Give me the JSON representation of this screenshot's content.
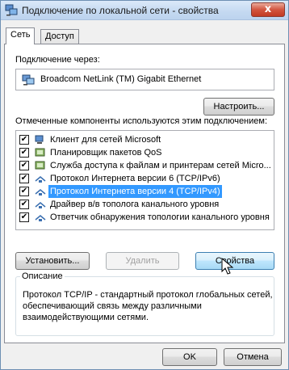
{
  "window": {
    "title": "Подключение по локальной сети - свойства",
    "close_glyph": "x"
  },
  "tabs": [
    {
      "label": "Сеть"
    },
    {
      "label": "Доступ"
    }
  ],
  "connect_via": {
    "label": "Подключение через:",
    "adapter": "Broadcom NetLink (TM) Gigabit Ethernet",
    "configure_button": "Настроить..."
  },
  "components": {
    "label": "Отмеченные компоненты используются этим подключением:",
    "items": [
      {
        "label": "Клиент для сетей Microsoft",
        "checked": true,
        "icon": "network-client-icon"
      },
      {
        "label": "Планировщик пакетов QoS",
        "checked": true,
        "icon": "network-service-icon"
      },
      {
        "label": "Служба доступа к файлам и принтерам сетей Micro...",
        "checked": true,
        "icon": "network-service-icon"
      },
      {
        "label": "Протокол Интернета версии 6 (TCP/IPv6)",
        "checked": true,
        "icon": "protocol-icon"
      },
      {
        "label": "Протокол Интернета версии 4 (TCP/IPv4)",
        "checked": true,
        "icon": "protocol-icon",
        "selected": true
      },
      {
        "label": "Драйвер в/в тополога канального уровня",
        "checked": true,
        "icon": "protocol-icon"
      },
      {
        "label": "Ответчик обнаружения топологии канального уровня",
        "checked": true,
        "icon": "protocol-icon"
      }
    ],
    "check_glyph": "✔"
  },
  "buttons": {
    "install": "Установить...",
    "remove": "Удалить",
    "properties": "Свойства",
    "ok": "OK",
    "cancel": "Отмена"
  },
  "description": {
    "legend": "Описание",
    "text": "Протокол TCP/IP - стандартный протокол глобальных сетей, обеспечивающий связь между различными взаимодействующими сетями."
  },
  "colors": {
    "selection": "#3399ff",
    "title_bar": "#c4d9f1",
    "close_button": "#c23a22"
  }
}
